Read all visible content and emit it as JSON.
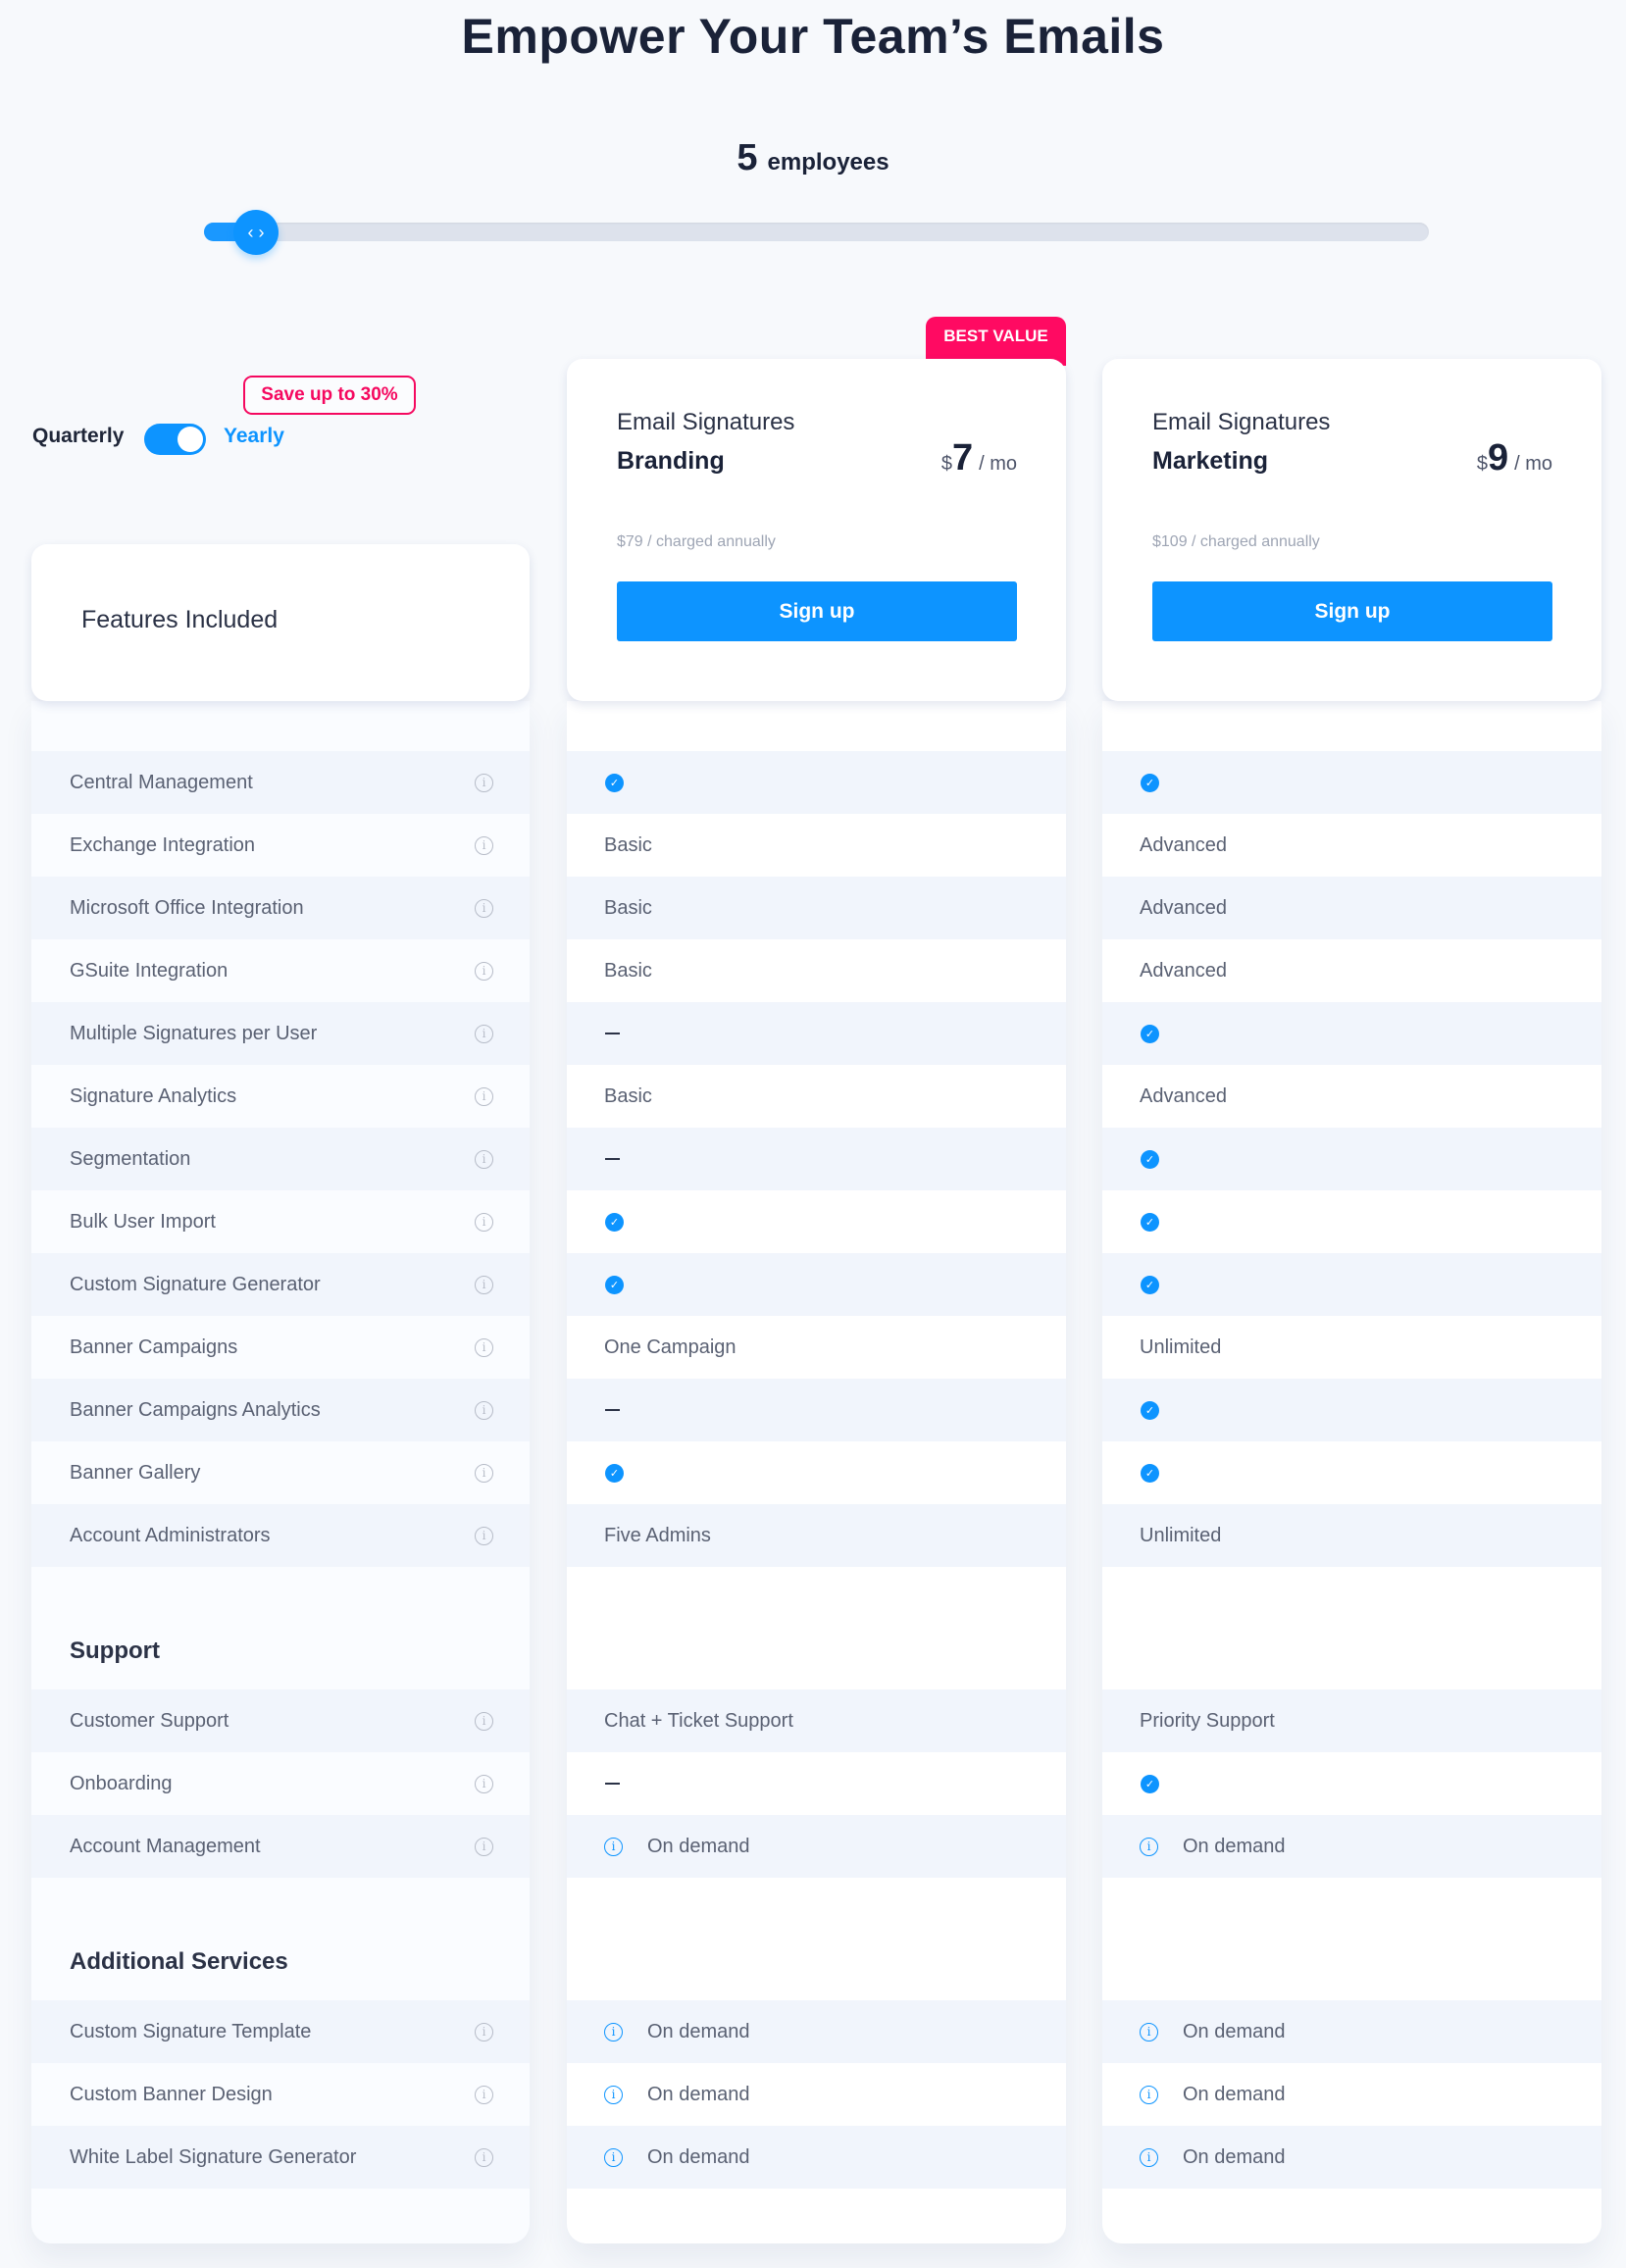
{
  "header": {
    "title": "Empower Your Team’s Emails",
    "employees_count": "5",
    "employees_label": "employees",
    "slider_value": 5,
    "slider_thumb_icon": "chevrons-left-right-icon"
  },
  "billing": {
    "save_badge": "Save up to 30%",
    "quarterly_label": "Quarterly",
    "yearly_label": "Yearly",
    "selected": "Yearly"
  },
  "features_card": {
    "title": "Features Included"
  },
  "plans": [
    {
      "pre_title": "Email Signatures",
      "name": "Branding",
      "currency": "$",
      "price": "7",
      "period": "/ mo",
      "annual_note": "$79 / charged annually",
      "signup_label": "Sign up",
      "badge": "BEST VALUE"
    },
    {
      "pre_title": "Email Signatures",
      "name": "Marketing",
      "currency": "$",
      "price": "9",
      "period": "/ mo",
      "annual_note": "$109 / charged annually",
      "signup_label": "Sign up",
      "badge": ""
    }
  ],
  "sections": [
    {
      "heading": "",
      "rows": [
        {
          "feature": "Central Management",
          "branding": {
            "type": "check"
          },
          "marketing": {
            "type": "check"
          }
        },
        {
          "feature": "Exchange Integration",
          "branding": {
            "type": "text",
            "text": "Basic"
          },
          "marketing": {
            "type": "text",
            "text": "Advanced"
          }
        },
        {
          "feature": "Microsoft Office Integration",
          "branding": {
            "type": "text",
            "text": "Basic"
          },
          "marketing": {
            "type": "text",
            "text": "Advanced"
          }
        },
        {
          "feature": "GSuite Integration",
          "branding": {
            "type": "text",
            "text": "Basic"
          },
          "marketing": {
            "type": "text",
            "text": "Advanced"
          }
        },
        {
          "feature": "Multiple Signatures per User",
          "branding": {
            "type": "dash"
          },
          "marketing": {
            "type": "check"
          }
        },
        {
          "feature": "Signature Analytics",
          "branding": {
            "type": "text",
            "text": "Basic"
          },
          "marketing": {
            "type": "text",
            "text": "Advanced"
          }
        },
        {
          "feature": "Segmentation",
          "branding": {
            "type": "dash"
          },
          "marketing": {
            "type": "check"
          }
        },
        {
          "feature": "Bulk User Import",
          "branding": {
            "type": "check"
          },
          "marketing": {
            "type": "check"
          }
        },
        {
          "feature": "Custom Signature Generator",
          "branding": {
            "type": "check"
          },
          "marketing": {
            "type": "check"
          }
        },
        {
          "feature": "Banner Campaigns",
          "branding": {
            "type": "text",
            "text": "One Campaign"
          },
          "marketing": {
            "type": "text",
            "text": "Unlimited"
          }
        },
        {
          "feature": "Banner Campaigns Analytics",
          "branding": {
            "type": "dash"
          },
          "marketing": {
            "type": "check"
          }
        },
        {
          "feature": "Banner Gallery",
          "branding": {
            "type": "check"
          },
          "marketing": {
            "type": "check"
          }
        },
        {
          "feature": "Account Administrators",
          "branding": {
            "type": "text",
            "text": "Five Admins"
          },
          "marketing": {
            "type": "text",
            "text": "Unlimited"
          }
        }
      ]
    },
    {
      "heading": "Support",
      "rows": [
        {
          "feature": "Customer Support",
          "branding": {
            "type": "text",
            "text": "Chat + Ticket Support"
          },
          "marketing": {
            "type": "text",
            "text": "Priority Support"
          }
        },
        {
          "feature": "Onboarding",
          "branding": {
            "type": "dash"
          },
          "marketing": {
            "type": "check"
          }
        },
        {
          "feature": "Account Management",
          "branding": {
            "type": "ondemand",
            "text": "On demand"
          },
          "marketing": {
            "type": "ondemand",
            "text": "On demand"
          }
        }
      ]
    },
    {
      "heading": "Additional Services",
      "rows": [
        {
          "feature": "Custom Signature Template",
          "branding": {
            "type": "ondemand",
            "text": "On demand"
          },
          "marketing": {
            "type": "ondemand",
            "text": "On demand"
          }
        },
        {
          "feature": "Custom Banner Design",
          "branding": {
            "type": "ondemand",
            "text": "On demand"
          },
          "marketing": {
            "type": "ondemand",
            "text": "On demand"
          }
        },
        {
          "feature": "White Label Signature Generator",
          "branding": {
            "type": "ondemand",
            "text": "On demand"
          },
          "marketing": {
            "type": "ondemand",
            "text": "On demand"
          }
        }
      ]
    }
  ],
  "icons": {
    "check": "✓",
    "info": "i",
    "thumb": "‹ ›"
  },
  "colors": {
    "accent": "#0d94ff",
    "badge": "#ff0a62",
    "save_badge": "#f5085f",
    "text_dark": "#1a2238",
    "row_alt": "#f1f5fc"
  }
}
